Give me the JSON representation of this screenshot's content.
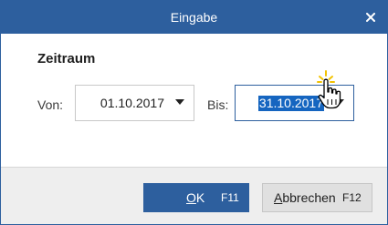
{
  "dialog": {
    "title": "Eingabe",
    "close_icon": "close-icon"
  },
  "section": {
    "title": "Zeitraum"
  },
  "fields": {
    "von": {
      "label": "Von:",
      "value": "01.10.2017"
    },
    "bis": {
      "label": "Bis:",
      "value": "31.10.2017",
      "selected": true
    }
  },
  "buttons": {
    "ok": {
      "mnemonic": "O",
      "rest": "K",
      "shortcut": "F11"
    },
    "cancel": {
      "mnemonic": "A",
      "rest": "bbrechen",
      "shortcut": "F12"
    }
  },
  "colors": {
    "accent": "#2d5f9e",
    "selection": "#1565c0",
    "footer_bg": "#eeeeee"
  },
  "cursor_icon": "hand-pointer-icon"
}
